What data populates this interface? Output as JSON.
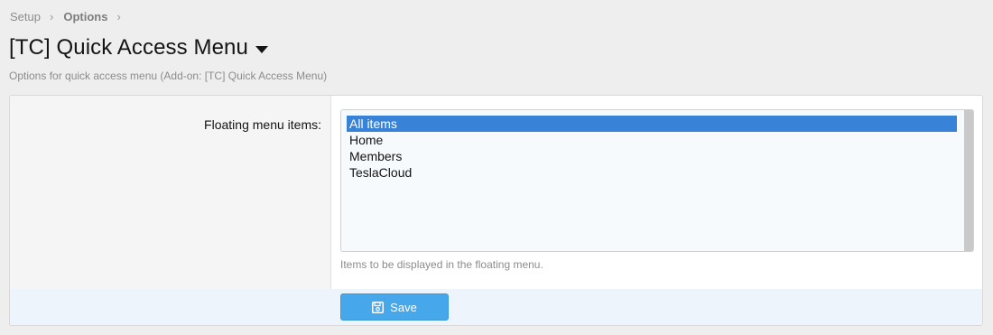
{
  "breadcrumb": {
    "items": [
      "Setup",
      "Options"
    ],
    "separator": "›"
  },
  "header": {
    "title": "[TC] Quick Access Menu",
    "description": "Options for quick access menu (Add-on: [TC] Quick Access Menu)"
  },
  "form": {
    "floating_menu": {
      "label": "Floating menu items:",
      "options": [
        "All items",
        "Home",
        "Members",
        "TeslaCloud"
      ],
      "selected": "All items",
      "explain": "Items to be displayed in the floating menu."
    },
    "save_label": "Save"
  },
  "colors": {
    "accent": "#47a7eb",
    "selection": "#3883d7"
  },
  "icons": {
    "title_menu": "caret-down-icon",
    "save": "floppy-disk-icon"
  }
}
